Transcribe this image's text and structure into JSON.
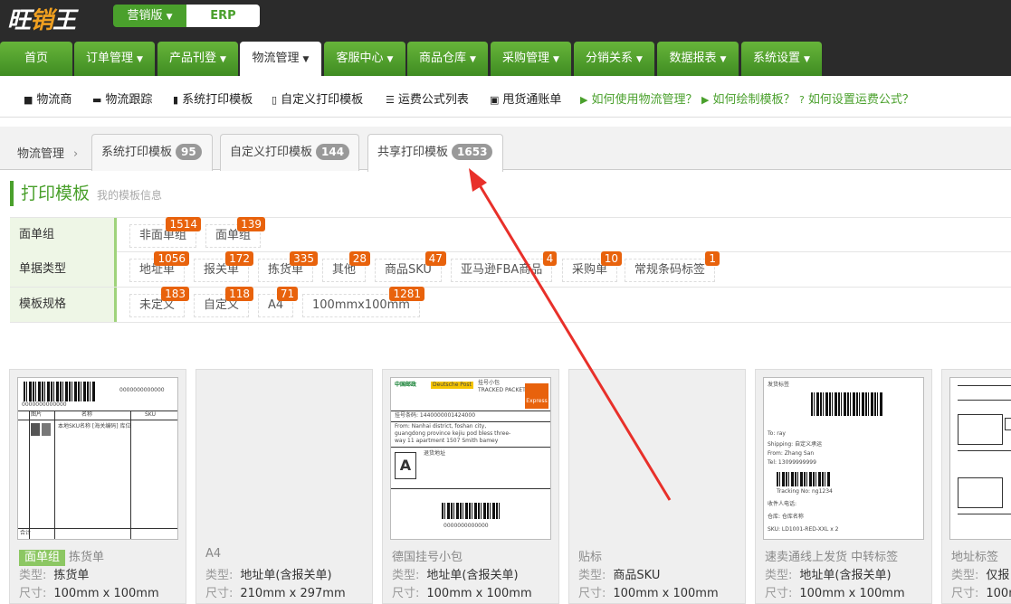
{
  "logo": {
    "text_a": "旺",
    "text_b": "销",
    "text_c": "王"
  },
  "edition": {
    "marketing": "营销版",
    "erp": "ERP"
  },
  "nav": [
    {
      "label": "首页",
      "caret": false
    },
    {
      "label": "订单管理",
      "caret": true
    },
    {
      "label": "产品刊登",
      "caret": true
    },
    {
      "label": "物流管理",
      "caret": true,
      "active": true
    },
    {
      "label": "客服中心",
      "caret": true
    },
    {
      "label": "商品仓库",
      "caret": true
    },
    {
      "label": "采购管理",
      "caret": true
    },
    {
      "label": "分销关系",
      "caret": true
    },
    {
      "label": "数据报表",
      "caret": true
    },
    {
      "label": "系统设置",
      "caret": true
    }
  ],
  "subnav": [
    {
      "icon": "truck-icon",
      "label": "物流商"
    },
    {
      "icon": "tracking-icon",
      "label": "物流跟踪"
    },
    {
      "icon": "bookmark-icon",
      "label": "系统打印模板"
    },
    {
      "icon": "bookmark-outline-icon",
      "label": "自定义打印模板"
    },
    {
      "icon": "list-icon",
      "label": "运费公式列表"
    },
    {
      "icon": "bill-icon",
      "label": "甩货通账单"
    },
    {
      "icon": "video-icon",
      "label": "如何使用物流管理？"
    },
    {
      "icon": "video-icon",
      "label": "如何绘制模板？"
    },
    {
      "icon": "help-icon",
      "label": "如何设置运费公式？"
    }
  ],
  "breadcrumb": "物流管理",
  "tabs": [
    {
      "label": "系统打印模板",
      "count": "95"
    },
    {
      "label": "自定义打印模板",
      "count": "144"
    },
    {
      "label": "共享打印模板",
      "count": "1653",
      "active": true
    }
  ],
  "page_title": "打印模板",
  "page_subtitle": "我的模板信息",
  "filters": {
    "group": {
      "label": "面单组",
      "options": [
        {
          "label": "非面单组",
          "count": "1514"
        },
        {
          "label": "面单组",
          "count": "139"
        }
      ]
    },
    "doc_type": {
      "label": "单据类型",
      "options": [
        {
          "label": "地址单",
          "count": "1056"
        },
        {
          "label": "报关单",
          "count": "172"
        },
        {
          "label": "拣货单",
          "count": "335"
        },
        {
          "label": "其他",
          "count": "28"
        },
        {
          "label": "商品SKU",
          "count": "47"
        },
        {
          "label": "亚马逊FBA商品",
          "count": "4"
        },
        {
          "label": "采购单",
          "count": "10"
        },
        {
          "label": "常规条码标签",
          "count": "1"
        }
      ]
    },
    "spec": {
      "label": "模板规格",
      "options": [
        {
          "label": "未定义",
          "count": "183"
        },
        {
          "label": "自定义",
          "count": "118"
        },
        {
          "label": "A4",
          "count": "71"
        },
        {
          "label": "100mmx100mm",
          "count": "1281"
        }
      ]
    }
  },
  "cards": [
    {
      "group": "面单组",
      "name": "拣货单",
      "type": "拣货单",
      "size": "100mm x 100mm"
    },
    {
      "group": "",
      "name": "A4",
      "type": "地址单(含报关单)",
      "size": "210mm x 297mm"
    },
    {
      "group": "",
      "name": "德国挂号小包",
      "type": "地址单(含报关单)",
      "size": "100mm x 100mm"
    },
    {
      "group": "",
      "name": "贴标",
      "type": "商品SKU",
      "size": "100mm x 100mm"
    },
    {
      "group": "",
      "name": "速卖通线上发货 中转标签",
      "type": "地址单(含报关单)",
      "size": "100mm x 100mm"
    },
    {
      "group": "",
      "name": "地址标签",
      "type": "仅报",
      "size": "100m"
    }
  ],
  "card_labels": {
    "type": "类型:",
    "size": "尺寸:"
  },
  "thumb_text": {
    "barcode_num": "0000000000000",
    "picking_cols": [
      "图片",
      "名称",
      "SKU"
    ],
    "picking_row": "本地SKU名称 [海关编码] 库位",
    "total": "合计",
    "post_cn": "中国邮政",
    "post_de": "Deutsche Post",
    "registered": "挂号小包",
    "tracked": "TRACKED PACKET",
    "express": "Express",
    "tracking_no": "挂号条码: 1440000001424000",
    "from": "From: Nanhai district, foshan city, guangdong province kejiu pod bless three-way 11 apartment 1507 Smith bamey",
    "zone": "A",
    "returns": "退货地址",
    "shipping_label": "发货标签",
    "to": "To: ray",
    "shipping": "Shipping: 自定义承运",
    "from_name": "From: Zhang San",
    "tel": "Tel: 13099999999",
    "tracking": "Tracking No: ng1234",
    "receiver": "收件人电话:",
    "warehouse": "仓库: 仓库名称",
    "sku_line": "SKU: LD1001-RED-XXL x 2"
  }
}
